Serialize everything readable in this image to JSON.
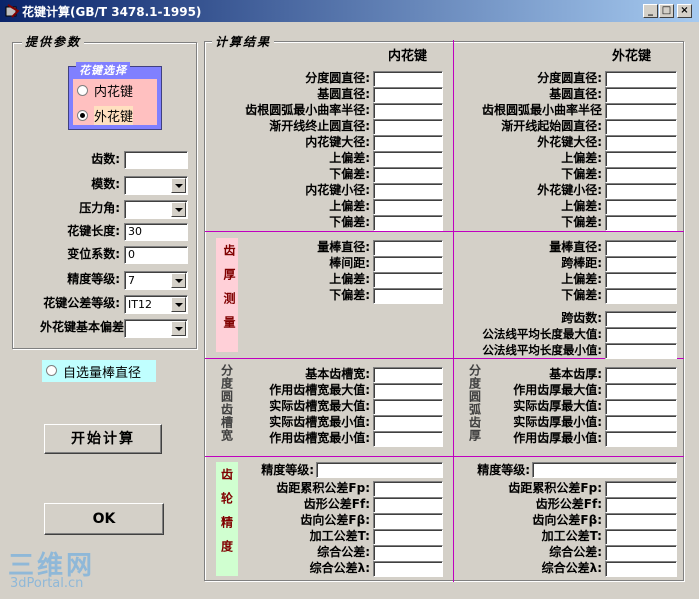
{
  "window": {
    "title": "花键计算(GB/T 3478.1-1995)",
    "minimize": "_",
    "restore": "□",
    "close": "×"
  },
  "params": {
    "group_title": "提供参数",
    "spline_select": {
      "title": "花键选择",
      "options": [
        "内花键",
        "外花键"
      ],
      "selected": "外花键"
    },
    "tooth_count": {
      "label": "齿数:",
      "value": ""
    },
    "module": {
      "label": "模数:",
      "value": ""
    },
    "pressure_angle": {
      "label": "压力角:",
      "value": ""
    },
    "spline_length": {
      "label": "花键长度:",
      "value": "30"
    },
    "shift_coeff": {
      "label": "变位系数:",
      "value": "0"
    },
    "accuracy_grade": {
      "label": "精度等级:",
      "value": "7"
    },
    "tolerance_grade": {
      "label": "花键公差等级:",
      "value": "IT12"
    },
    "ext_basic_dev": {
      "label": "外花键基本偏差",
      "value": ""
    }
  },
  "custom_pin": {
    "label": "自选量棒直径",
    "checked": false
  },
  "buttons": {
    "calculate": "开始计算",
    "ok": "OK"
  },
  "results": {
    "group_title": "计算结果",
    "internal_header": "内花键",
    "external_header": "外花键",
    "internal_dims": [
      "分度圆直径:",
      "基圆直径:",
      "齿根圆弧最小曲率半径:",
      "渐开线终止圆直径:",
      "内花键大径:",
      "上偏差:",
      "下偏差:",
      "内花键小径:",
      "上偏差:",
      "下偏差:"
    ],
    "external_dims": [
      "分度圆直径:",
      "基圆直径:",
      "齿根圆弧最小曲率半径",
      "渐开线起始圆直径:",
      "外花键大径:",
      "上偏差:",
      "下偏差:",
      "外花键小径:",
      "上偏差:",
      "下偏差:"
    ],
    "measure_section": "齿厚测量",
    "internal_measure": [
      "量棒直径:",
      "棒间距:",
      "上偏差:",
      "下偏差:"
    ],
    "external_measure": [
      "量棒直径:",
      "跨棒距:",
      "上偏差:",
      "下偏差:"
    ],
    "external_span": [
      "跨齿数:",
      "公法线平均长度最大值:",
      "公法线平均长度最小值:"
    ],
    "internal_space_section": "分度圆齿槽宽",
    "internal_space": [
      "基本齿槽宽:",
      "作用齿槽宽最大值:",
      "实际齿槽宽最大值:",
      "实际齿槽宽最小值:",
      "作用齿槽宽最小值:"
    ],
    "external_thick_section": "分度圆弧齿厚",
    "external_thick": [
      "基本齿厚:",
      "作用齿厚最大值:",
      "实际齿厚最大值:",
      "实际齿厚最小值:",
      "作用齿厚最小值:"
    ],
    "gear_accuracy_section": "齿轮精度",
    "accuracy_grade_label": "精度等级:",
    "internal_accuracy": [
      "齿距累积公差Fp:",
      "齿形公差Ff:",
      "齿向公差Fβ:",
      "加工公差T:",
      "综合公差:",
      "综合公差λ:"
    ],
    "external_accuracy": [
      "齿距累积公差Fp:",
      "齿形公差Ff:",
      "齿向公差Fβ:",
      "加工公差T:",
      "综合公差:",
      "综合公差λ:"
    ]
  },
  "watermark": {
    "line1": "三维网",
    "line2": "3dPortal.cn"
  }
}
